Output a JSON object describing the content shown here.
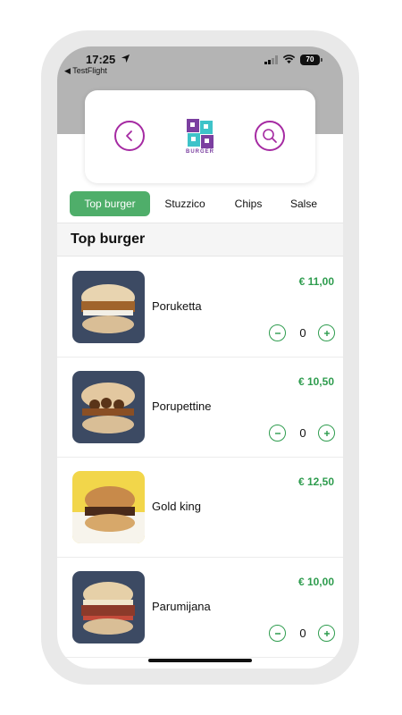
{
  "status_bar": {
    "time": "17:25",
    "back_app": "◀ TestFlight",
    "battery": "70"
  },
  "header": {
    "logo_text": "BURGER",
    "accent_color": "#a52aa2"
  },
  "tabs": [
    {
      "label": "Top burger",
      "active": true
    },
    {
      "label": "Stuzzico",
      "active": false
    },
    {
      "label": "Chips",
      "active": false
    },
    {
      "label": "Salse",
      "active": false
    }
  ],
  "section": {
    "title": "Top burger"
  },
  "products": [
    {
      "name": "Poruketta",
      "price": "€ 11,00",
      "quantity": "0",
      "has_stepper": true
    },
    {
      "name": "Porupettine",
      "price": "€ 10,50",
      "quantity": "0",
      "has_stepper": true
    },
    {
      "name": "Gold king",
      "price": "€ 12,50",
      "quantity": "",
      "has_stepper": false
    },
    {
      "name": "Parumijana",
      "price": "€ 10,00",
      "quantity": "0",
      "has_stepper": true
    }
  ],
  "colors": {
    "active_tab": "#4fae6a",
    "price": "#2e9c4e"
  }
}
